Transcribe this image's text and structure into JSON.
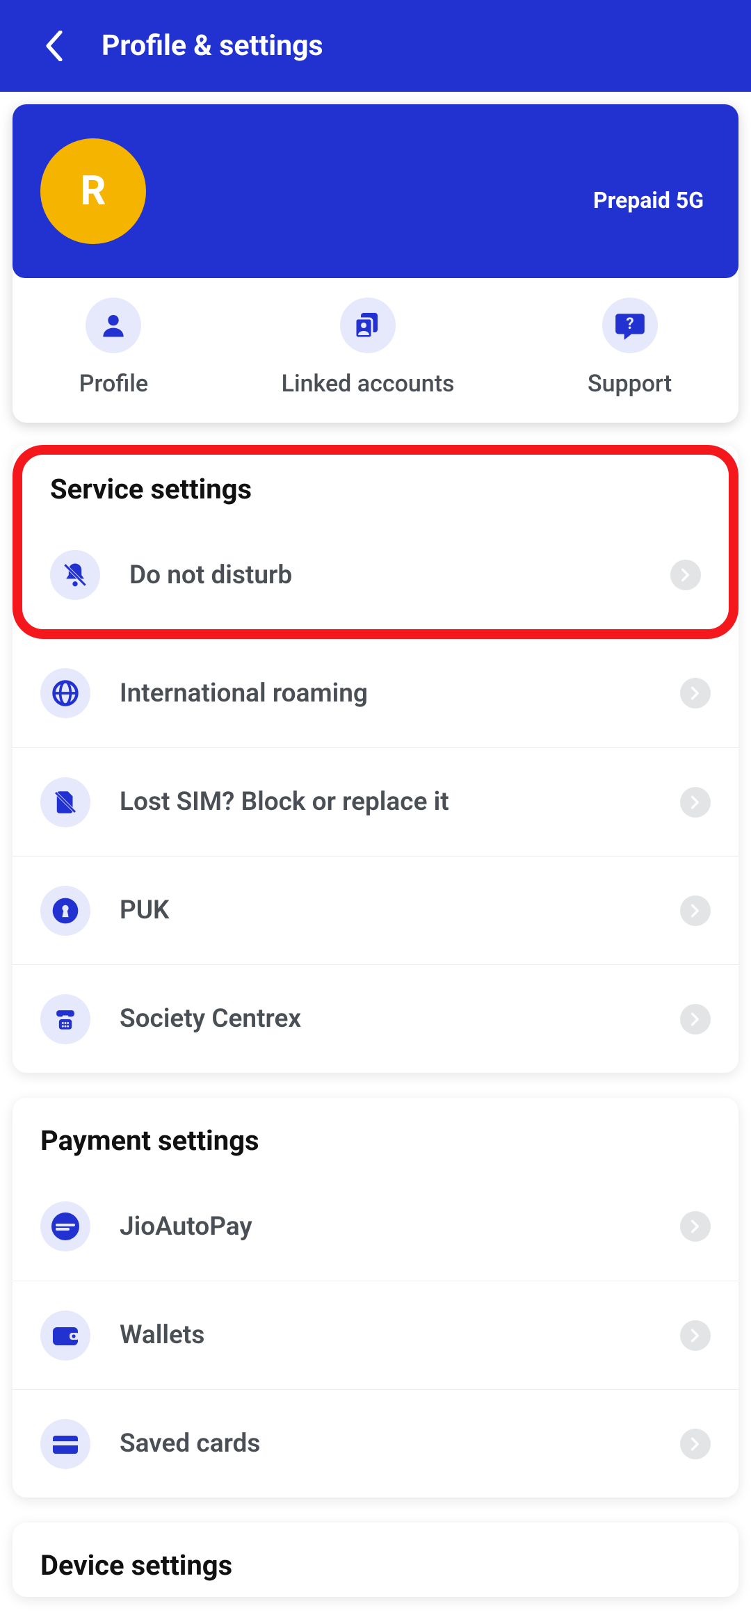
{
  "header": {
    "title": "Profile & settings"
  },
  "profile": {
    "avatar_initial": "R",
    "plan": "Prepaid 5G",
    "actions": {
      "profile": "Profile",
      "linked": "Linked accounts",
      "support": "Support"
    }
  },
  "sections": {
    "service": {
      "title": "Service settings",
      "items": {
        "dnd": "Do not disturb",
        "roaming": "International roaming",
        "lost_sim": "Lost SIM? Block or replace it",
        "puk": "PUK",
        "centrex": "Society Centrex"
      }
    },
    "payment": {
      "title": "Payment settings",
      "items": {
        "autopay": "JioAutoPay",
        "wallets": "Wallets",
        "cards": "Saved cards"
      }
    },
    "device": {
      "title": "Device settings"
    }
  },
  "colors": {
    "brand": "#2232d0",
    "accent": "#f5b400",
    "highlight": "#f4181c"
  }
}
